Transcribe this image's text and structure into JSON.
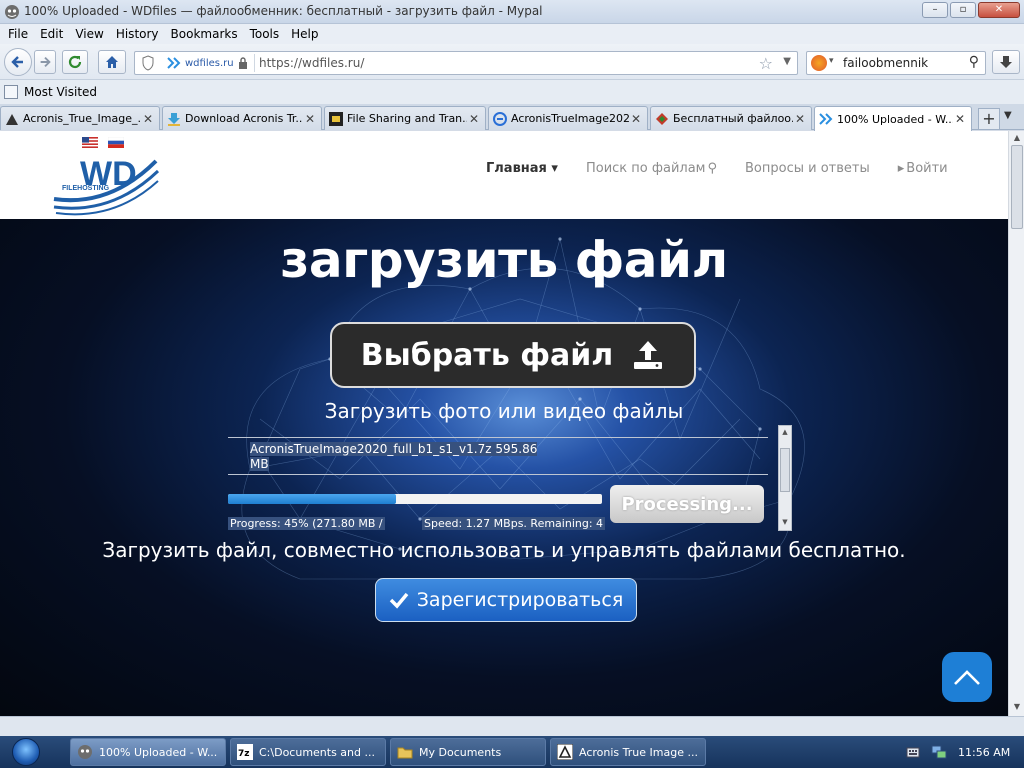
{
  "window": {
    "title": "100% Uploaded - WDfiles — файлообменник: бесплатный - загрузить файл - Mypal",
    "buttons": [
      "minimize",
      "maximize",
      "close"
    ]
  },
  "menubar": [
    "File",
    "Edit",
    "View",
    "History",
    "Bookmarks",
    "Tools",
    "Help"
  ],
  "navbar": {
    "site_identity": "wdfiles.ru",
    "url": "https://wdfiles.ru/",
    "search_query": "failoobmennik"
  },
  "bookmarks": {
    "most_visited": "Most Visited"
  },
  "tabs": [
    {
      "label": "Acronis_True_Image_...",
      "icon": "acronis-icon",
      "active": false
    },
    {
      "label": "Download Acronis Tr...",
      "icon": "download-icon",
      "active": false
    },
    {
      "label": "File Sharing and Tran...",
      "icon": "filesharing-icon",
      "active": false
    },
    {
      "label": "AcronisTrueImage202...",
      "icon": "acronis-icon",
      "active": false
    },
    {
      "label": "Бесплатный файлоо...",
      "icon": "leaf-icon",
      "active": false
    },
    {
      "label": "100% Uploaded - W...",
      "icon": "wdfiles-icon",
      "active": true
    }
  ],
  "site": {
    "logo_text": "WD",
    "logo_sub": "FILEHOSTING",
    "nav": [
      {
        "label": "Главная ▾",
        "active": true
      },
      {
        "label": "Поиск по файлам",
        "active": false
      },
      {
        "label": "Вопросы и ответы",
        "active": false
      },
      {
        "label": "Войти",
        "active": false
      }
    ],
    "hero_title": "загрузить файл",
    "choose_button": "Выбрать файл",
    "subtitle": "Загрузить фото или видео файлы",
    "file_name_line1": "AcronisTrueImage2020_full_b1_s1_v1.7z  595.86",
    "file_name_line2": "MB",
    "progress_fraction": 0.45,
    "processing_button": "Processing...",
    "progress_text": "Progress: 45% (271.80 MB /",
    "speed_text": "Speed: 1.27 MBps. Remaining: 4",
    "tagline": "Загрузить файл, совместно использовать и управлять файлами бесплатно.",
    "register_button": "Зарегистрироваться"
  },
  "taskbar": {
    "tasks": [
      {
        "label": "100% Uploaded - W...",
        "icon": "mypal-icon",
        "active": true
      },
      {
        "label": "C:\\Documents and ...",
        "icon": "7zip-icon",
        "active": false
      },
      {
        "label": "My Documents",
        "icon": "folder-icon",
        "active": false
      },
      {
        "label": "Acronis True Image ...",
        "icon": "acronis-icon",
        "active": false
      }
    ],
    "clock": "11:56 AM"
  },
  "colors": {
    "accent_blue": "#1e7fd6",
    "hero_dark": "#060f24",
    "progress_fill": "#1f7fd1"
  }
}
